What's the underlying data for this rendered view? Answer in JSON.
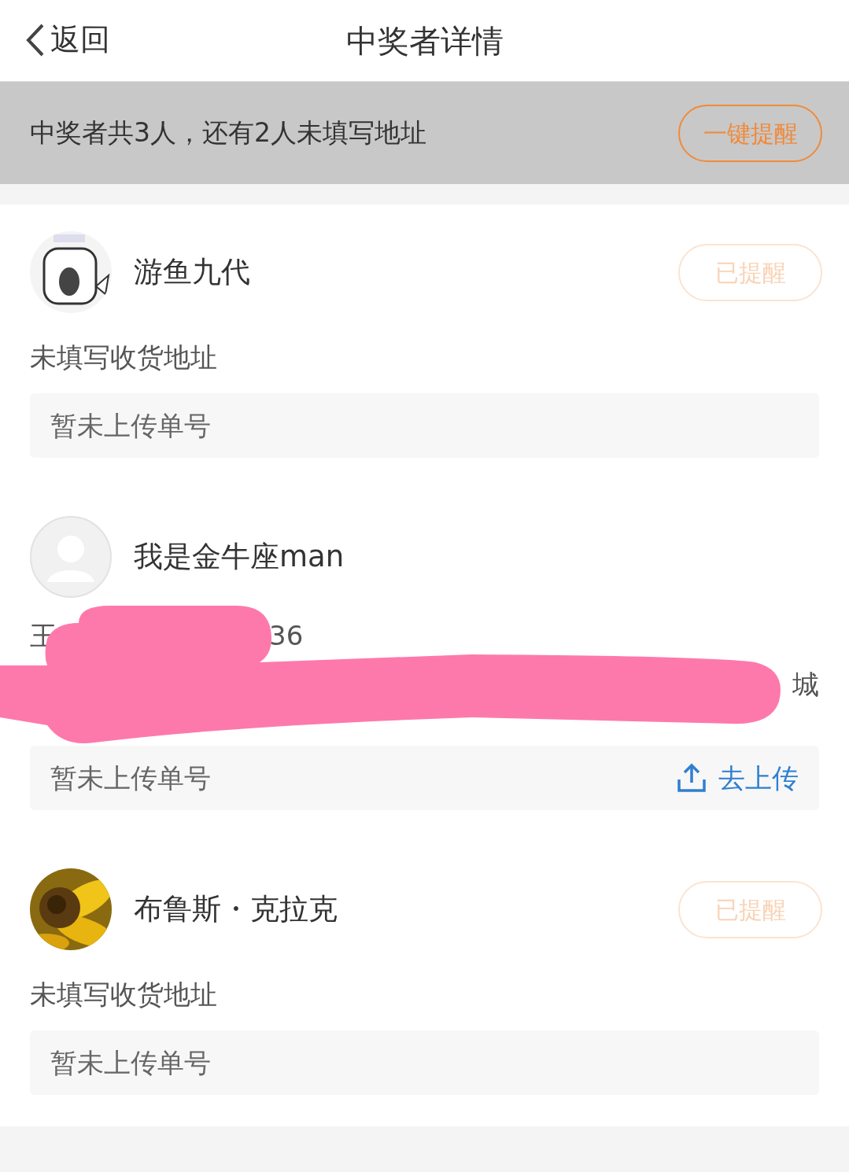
{
  "header": {
    "back": "返回",
    "title": "中奖者详情"
  },
  "summary": {
    "text": "中奖者共3人，还有2人未填写地址",
    "button": "一键提醒"
  },
  "winners": [
    {
      "name": "游鱼九代",
      "avatar": {
        "kind": "cartoon"
      },
      "remind_button": {
        "label": "已提醒",
        "disabled": true
      },
      "address": {
        "kind": "missing",
        "text": "未填写收货地址"
      },
      "tracking": {
        "text": "暂未上传单号"
      }
    },
    {
      "name": "我是金牛座man",
      "avatar": {
        "kind": "default"
      },
      "address": {
        "kind": "redacted",
        "contact_start": "王",
        "contact_end": "36",
        "line_end": "城"
      },
      "tracking": {
        "text": "暂未上传单号",
        "action": "去上传"
      }
    },
    {
      "name": "布鲁斯・克拉克",
      "remind_button": {
        "label": "已提醒",
        "disabled": true
      },
      "address": {
        "kind": "missing",
        "text": "未填写收货地址"
      },
      "tracking": {
        "text": "暂未上传单号"
      }
    }
  ]
}
